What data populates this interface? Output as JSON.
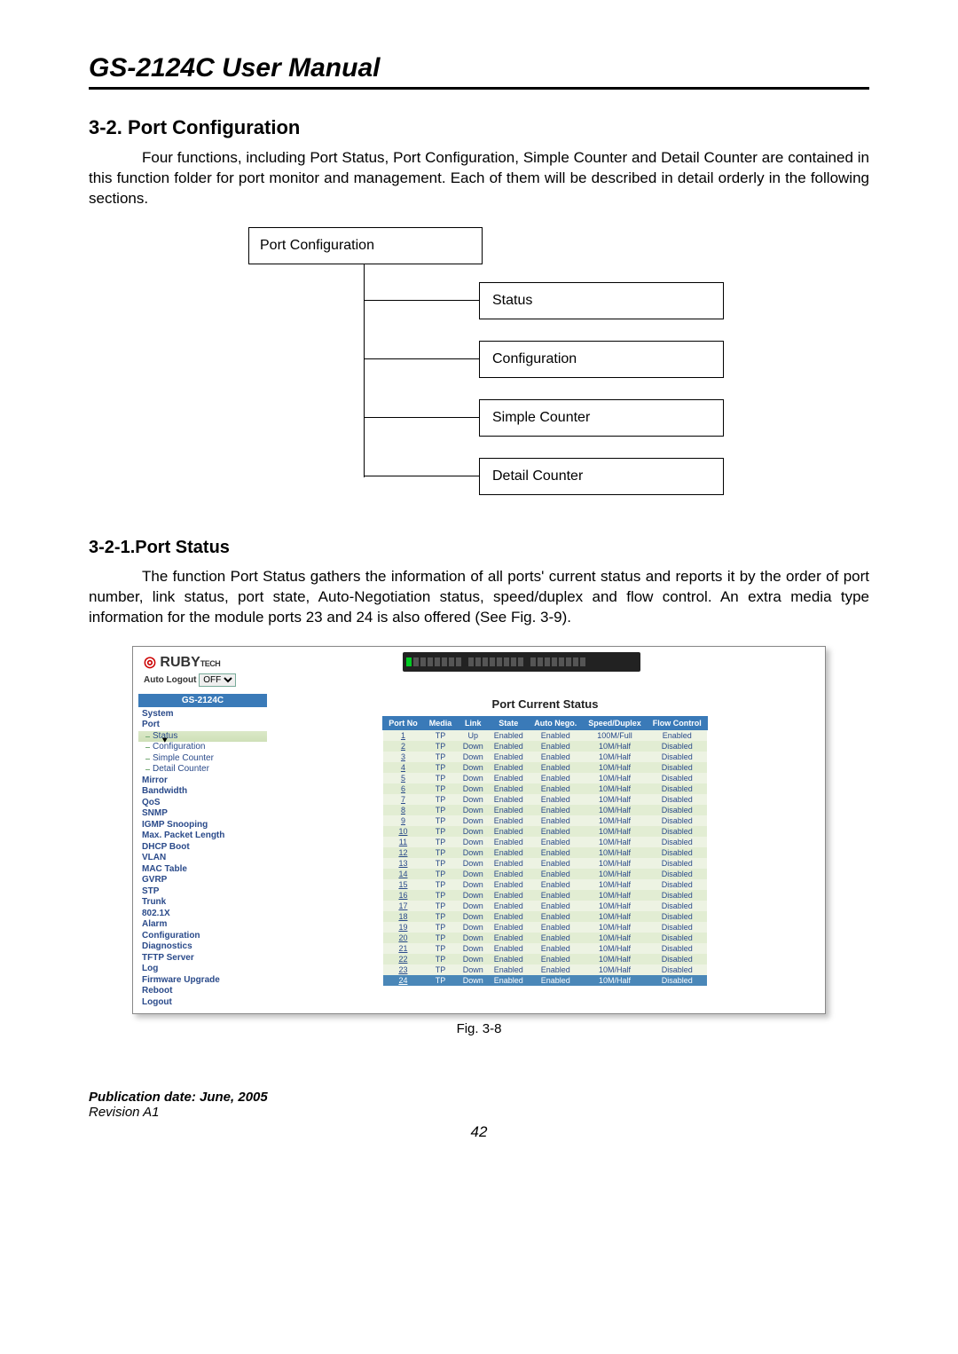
{
  "manual_title": "GS-2124C User Manual",
  "section_number_title": "3-2. Port Configuration",
  "section_intro": "Four functions, including Port Status, Port Configuration, Simple Counter and Detail Counter are contained in this function folder for port monitor and management. Each of them will be described in detail orderly in the following sections.",
  "diagram": {
    "root": "Port Configuration",
    "items": [
      "Status",
      "Configuration",
      "Simple Counter",
      "Detail Counter"
    ]
  },
  "subsection_title": "3-2-1.Port Status",
  "subsection_para": "The function Port Status gathers the information of all ports' current status and reports it by the order of port number, link status, port state, Auto-Negotiation status, speed/duplex and flow control. An extra media type information for the module ports 23 and 24 is also offered (See Fig. 3-9).",
  "fig_caption": "Fig. 3-8",
  "pub_date": "Publication date: June, 2005",
  "revision": "Revision A1",
  "page_number": "42",
  "screenshot": {
    "logo_prefix": "RUBY",
    "auto_logout_label": "Auto Logout",
    "auto_logout_value": "OFF",
    "model": "GS-2124C",
    "sidebar": [
      {
        "label": "System",
        "cls": "top"
      },
      {
        "label": "Port",
        "cls": "top"
      },
      {
        "label": "Status",
        "cls": "sub sel cursor-ptr"
      },
      {
        "label": "Configuration",
        "cls": "sub"
      },
      {
        "label": "Simple Counter",
        "cls": "sub"
      },
      {
        "label": "Detail Counter",
        "cls": "sub"
      },
      {
        "label": "Mirror",
        "cls": "top"
      },
      {
        "label": "Bandwidth",
        "cls": "top"
      },
      {
        "label": "QoS",
        "cls": "top"
      },
      {
        "label": "SNMP",
        "cls": "top"
      },
      {
        "label": "IGMP Snooping",
        "cls": "top"
      },
      {
        "label": "Max. Packet Length",
        "cls": "top"
      },
      {
        "label": "DHCP Boot",
        "cls": "top"
      },
      {
        "label": "VLAN",
        "cls": "top"
      },
      {
        "label": "MAC Table",
        "cls": "top"
      },
      {
        "label": "GVRP",
        "cls": "top"
      },
      {
        "label": "STP",
        "cls": "top"
      },
      {
        "label": "Trunk",
        "cls": "top"
      },
      {
        "label": "802.1X",
        "cls": "top"
      },
      {
        "label": "Alarm",
        "cls": "top"
      },
      {
        "label": "Configuration",
        "cls": "top"
      },
      {
        "label": "Diagnostics",
        "cls": "top"
      },
      {
        "label": "TFTP Server",
        "cls": "top"
      },
      {
        "label": "Log",
        "cls": "top"
      },
      {
        "label": "Firmware Upgrade",
        "cls": "top"
      },
      {
        "label": "Reboot",
        "cls": "top"
      },
      {
        "label": "Logout",
        "cls": "top"
      }
    ],
    "content_title": "Port Current Status",
    "headers": [
      "Port No",
      "Media",
      "Link",
      "State",
      "Auto Nego.",
      "Speed/Duplex",
      "Flow Control"
    ],
    "rows": [
      {
        "no": "1",
        "media": "TP",
        "link": "Up",
        "state": "Enabled",
        "auto": "Enabled",
        "sd": "100M/Full",
        "fc": "Enabled"
      },
      {
        "no": "2",
        "media": "TP",
        "link": "Down",
        "state": "Enabled",
        "auto": "Enabled",
        "sd": "10M/Half",
        "fc": "Disabled"
      },
      {
        "no": "3",
        "media": "TP",
        "link": "Down",
        "state": "Enabled",
        "auto": "Enabled",
        "sd": "10M/Half",
        "fc": "Disabled"
      },
      {
        "no": "4",
        "media": "TP",
        "link": "Down",
        "state": "Enabled",
        "auto": "Enabled",
        "sd": "10M/Half",
        "fc": "Disabled"
      },
      {
        "no": "5",
        "media": "TP",
        "link": "Down",
        "state": "Enabled",
        "auto": "Enabled",
        "sd": "10M/Half",
        "fc": "Disabled"
      },
      {
        "no": "6",
        "media": "TP",
        "link": "Down",
        "state": "Enabled",
        "auto": "Enabled",
        "sd": "10M/Half",
        "fc": "Disabled"
      },
      {
        "no": "7",
        "media": "TP",
        "link": "Down",
        "state": "Enabled",
        "auto": "Enabled",
        "sd": "10M/Half",
        "fc": "Disabled"
      },
      {
        "no": "8",
        "media": "TP",
        "link": "Down",
        "state": "Enabled",
        "auto": "Enabled",
        "sd": "10M/Half",
        "fc": "Disabled"
      },
      {
        "no": "9",
        "media": "TP",
        "link": "Down",
        "state": "Enabled",
        "auto": "Enabled",
        "sd": "10M/Half",
        "fc": "Disabled"
      },
      {
        "no": "10",
        "media": "TP",
        "link": "Down",
        "state": "Enabled",
        "auto": "Enabled",
        "sd": "10M/Half",
        "fc": "Disabled"
      },
      {
        "no": "11",
        "media": "TP",
        "link": "Down",
        "state": "Enabled",
        "auto": "Enabled",
        "sd": "10M/Half",
        "fc": "Disabled"
      },
      {
        "no": "12",
        "media": "TP",
        "link": "Down",
        "state": "Enabled",
        "auto": "Enabled",
        "sd": "10M/Half",
        "fc": "Disabled"
      },
      {
        "no": "13",
        "media": "TP",
        "link": "Down",
        "state": "Enabled",
        "auto": "Enabled",
        "sd": "10M/Half",
        "fc": "Disabled"
      },
      {
        "no": "14",
        "media": "TP",
        "link": "Down",
        "state": "Enabled",
        "auto": "Enabled",
        "sd": "10M/Half",
        "fc": "Disabled"
      },
      {
        "no": "15",
        "media": "TP",
        "link": "Down",
        "state": "Enabled",
        "auto": "Enabled",
        "sd": "10M/Half",
        "fc": "Disabled"
      },
      {
        "no": "16",
        "media": "TP",
        "link": "Down",
        "state": "Enabled",
        "auto": "Enabled",
        "sd": "10M/Half",
        "fc": "Disabled"
      },
      {
        "no": "17",
        "media": "TP",
        "link": "Down",
        "state": "Enabled",
        "auto": "Enabled",
        "sd": "10M/Half",
        "fc": "Disabled"
      },
      {
        "no": "18",
        "media": "TP",
        "link": "Down",
        "state": "Enabled",
        "auto": "Enabled",
        "sd": "10M/Half",
        "fc": "Disabled"
      },
      {
        "no": "19",
        "media": "TP",
        "link": "Down",
        "state": "Enabled",
        "auto": "Enabled",
        "sd": "10M/Half",
        "fc": "Disabled"
      },
      {
        "no": "20",
        "media": "TP",
        "link": "Down",
        "state": "Enabled",
        "auto": "Enabled",
        "sd": "10M/Half",
        "fc": "Disabled"
      },
      {
        "no": "21",
        "media": "TP",
        "link": "Down",
        "state": "Enabled",
        "auto": "Enabled",
        "sd": "10M/Half",
        "fc": "Disabled"
      },
      {
        "no": "22",
        "media": "TP",
        "link": "Down",
        "state": "Enabled",
        "auto": "Enabled",
        "sd": "10M/Half",
        "fc": "Disabled"
      },
      {
        "no": "23",
        "media": "TP",
        "link": "Down",
        "state": "Enabled",
        "auto": "Enabled",
        "sd": "10M/Half",
        "fc": "Disabled"
      },
      {
        "no": "24",
        "media": "TP",
        "link": "Down",
        "state": "Enabled",
        "auto": "Enabled",
        "sd": "10M/Half",
        "fc": "Disabled",
        "sel": true
      }
    ]
  }
}
